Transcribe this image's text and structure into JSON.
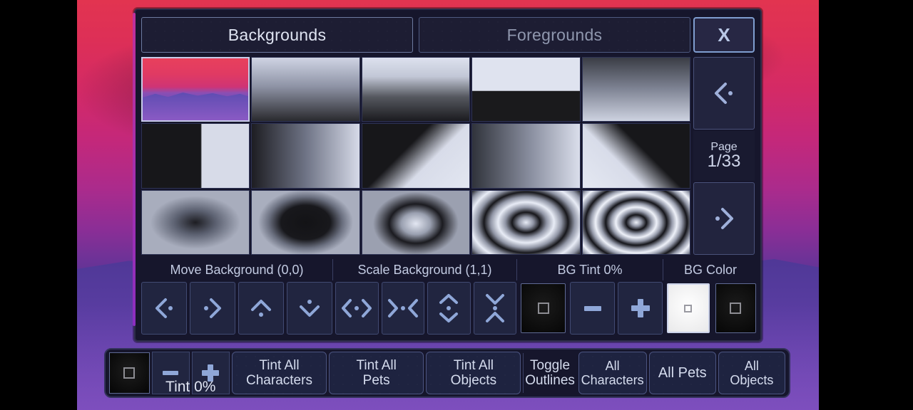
{
  "tabs": [
    {
      "label": "Backgrounds",
      "active": true
    },
    {
      "label": "Foregrounds",
      "active": false
    }
  ],
  "close_label": "X",
  "pager": {
    "prev_icon": "chevron-left-dot-icon",
    "next_icon": "chevron-right-dot-icon",
    "page_label": "Page",
    "page_value": "1/33"
  },
  "grid": {
    "thumbnails": [
      {
        "name": "mountain-scene",
        "selected": true
      },
      {
        "name": "vertical-gradient-white-black",
        "selected": false
      },
      {
        "name": "vertical-gradient-white-black-hard",
        "selected": false
      },
      {
        "name": "horizon-split",
        "selected": false
      },
      {
        "name": "vertical-gradient-black-white",
        "selected": false
      },
      {
        "name": "vertical-split",
        "selected": false
      },
      {
        "name": "horizontal-gradient-black-white",
        "selected": false
      },
      {
        "name": "diagonal-gradient-down",
        "selected": false
      },
      {
        "name": "horizontal-gradient-white-black",
        "selected": false
      },
      {
        "name": "diagonal-gradient-up",
        "selected": false
      },
      {
        "name": "radial-dark-center",
        "selected": false
      },
      {
        "name": "radial-ellipse-dark",
        "selected": false
      },
      {
        "name": "radial-light-center",
        "selected": false
      },
      {
        "name": "concentric-rings-wide",
        "selected": false
      },
      {
        "name": "concentric-rings-tight",
        "selected": false
      }
    ]
  },
  "controls": {
    "move": {
      "label": "Move Background (0,0)",
      "buttons": [
        {
          "name": "move-left-button",
          "icon": "chevron-left-dot-icon"
        },
        {
          "name": "move-right-button",
          "icon": "chevron-right-dot-icon"
        },
        {
          "name": "move-up-button",
          "icon": "chevron-up-dot-icon"
        },
        {
          "name": "move-down-button",
          "icon": "chevron-down-dot-icon"
        }
      ]
    },
    "scale": {
      "label": "Scale Background (1,1)",
      "buttons": [
        {
          "name": "scale-wider-button",
          "icon": "expand-horizontal-icon"
        },
        {
          "name": "scale-narrower-button",
          "icon": "contract-horizontal-icon"
        },
        {
          "name": "scale-taller-button",
          "icon": "expand-vertical-icon"
        },
        {
          "name": "scale-shorter-button",
          "icon": "contract-vertical-icon"
        }
      ]
    },
    "tint": {
      "label": "BG Tint 0%",
      "swatch": {
        "name": "bg-tint-swatch",
        "color": "#0a0a0a"
      },
      "decrease_label": "–",
      "increase_label": "+"
    },
    "color": {
      "label": "BG Color",
      "swatches": [
        {
          "name": "bg-color-white",
          "color": "#ffffff",
          "selected": true
        },
        {
          "name": "bg-color-black",
          "color": "#0a0a0a",
          "selected": false
        }
      ]
    }
  },
  "bottom_bar": {
    "tint_swatch": {
      "name": "global-tint-swatch",
      "color": "#0a0a0a"
    },
    "tint_label": "Tint 0%",
    "decrease_label": "–",
    "increase_label": "+",
    "tint_all_characters": "Tint All\nCharacters",
    "tint_all_pets": "Tint All\nPets",
    "tint_all_objects": "Tint All\nObjects",
    "toggle_outlines": "Toggle\nOutlines",
    "all_characters": "All\nCharacters",
    "all_pets": "All Pets",
    "all_objects": "All\nObjects"
  },
  "colors": {
    "panel_bg": "#16162c",
    "panel_border": "#2c2c48",
    "accent_edge": "#c0309a",
    "button_bg": "#212540",
    "button_border": "#414a72",
    "text": "#d5dcee",
    "icon": "#8fa7d8",
    "close_border": "#7f9ed0"
  }
}
